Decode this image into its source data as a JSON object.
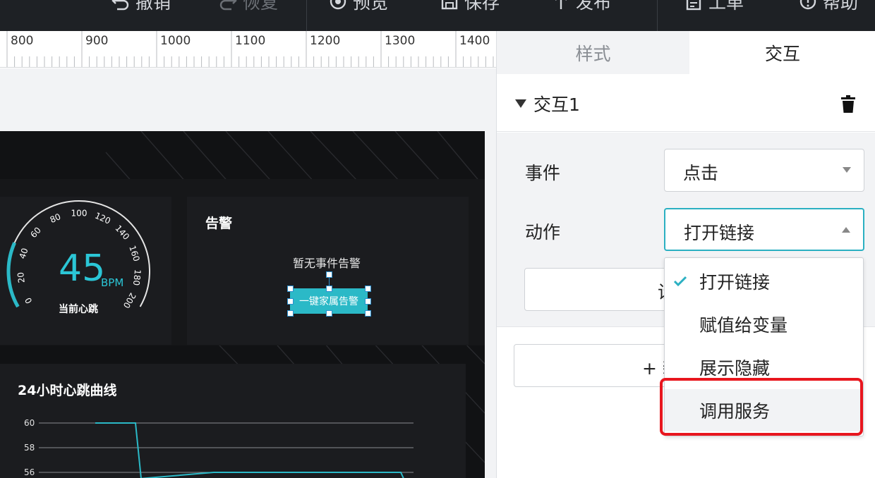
{
  "toolbar": {
    "items": [
      {
        "label": "撤销",
        "icon": "undo-icon"
      },
      {
        "label": "恢复",
        "icon": "redo-icon"
      },
      {
        "label": "预览",
        "icon": "eye-icon"
      },
      {
        "label": "保存",
        "icon": "save-icon"
      },
      {
        "label": "发布",
        "icon": "publish-icon"
      },
      {
        "label": "工单",
        "icon": "ticket-icon"
      },
      {
        "label": "帮助",
        "icon": "help-icon"
      }
    ]
  },
  "ruler": {
    "labels": [
      "800",
      "900",
      "1000",
      "1100",
      "1200",
      "1300",
      "1400"
    ]
  },
  "canvas": {
    "gauge": {
      "value": "45",
      "unit": "BPM",
      "caption": "当前心跳",
      "ticks": [
        "0",
        "20",
        "40",
        "60",
        "80",
        "100",
        "120",
        "140",
        "160",
        "180",
        "200"
      ]
    },
    "alarm_panel": {
      "title": "告警",
      "empty_text": "暂无事件告警",
      "button": "一键家属告警"
    },
    "chart_panel": {
      "title": "24小时心跳曲线"
    },
    "chart_data": {
      "type": "line",
      "title": "24小时心跳曲线",
      "y_ticks": [
        "60",
        "58",
        "56"
      ],
      "ylim": [
        56,
        60
      ],
      "grid": true,
      "series": [
        {
          "values": [
            60,
            60,
            60,
            55.5,
            56,
            56,
            56,
            56,
            55.5
          ]
        }
      ]
    }
  },
  "right_panel": {
    "tabs": [
      {
        "label": "样式",
        "active": false
      },
      {
        "label": "交互",
        "active": true
      }
    ],
    "interaction_title": "交互1",
    "event_label": "事件",
    "event_value": "点击",
    "action_label": "动作",
    "action_value": "打开链接",
    "hidden_button_partial": "设",
    "add_button_partial": "+ 新",
    "dropdown_options": [
      {
        "label": "打开链接",
        "selected": true
      },
      {
        "label": "赋值给变量",
        "selected": false
      },
      {
        "label": "展示隐藏",
        "selected": false
      },
      {
        "label": "调用服务",
        "selected": false
      }
    ]
  },
  "colors": {
    "accent": "#2bb0c2",
    "highlight": "#e8161e",
    "toolbar_bg": "#1e2125",
    "canvas_dark": "#111214"
  }
}
